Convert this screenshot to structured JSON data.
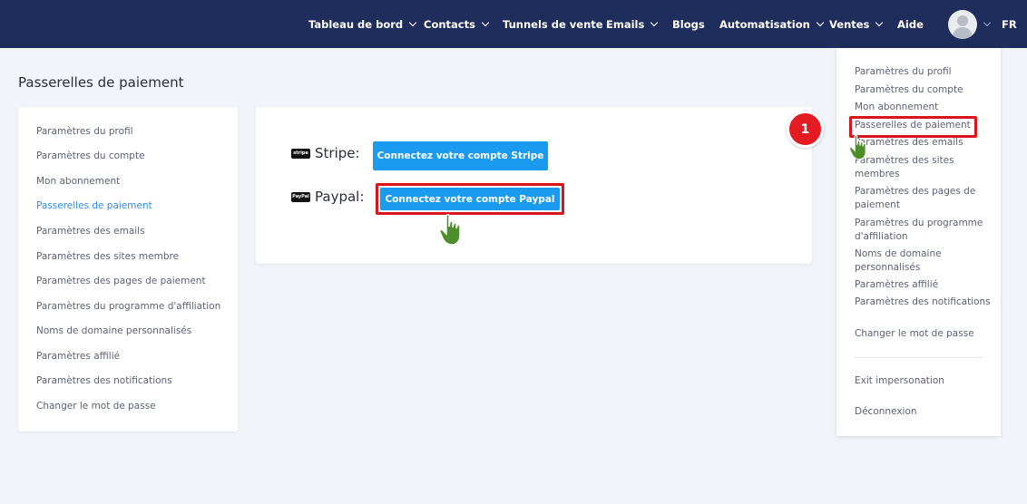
{
  "nav": {
    "items": [
      {
        "label": "Tableau de bord",
        "has_dropdown": true
      },
      {
        "label": "Contacts",
        "has_dropdown": true
      },
      {
        "label": "Tunnels de vente",
        "has_dropdown": false
      },
      {
        "label": "Emails",
        "has_dropdown": true
      },
      {
        "label": "Blogs",
        "has_dropdown": false
      },
      {
        "label": "Automatisation",
        "has_dropdown": true
      },
      {
        "label": "Ventes",
        "has_dropdown": true
      },
      {
        "label": "Aide",
        "has_dropdown": false
      }
    ],
    "language": "FR"
  },
  "page": {
    "title": "Passerelles de paiement"
  },
  "left_menu": {
    "items": [
      {
        "label": "Paramètres du profil",
        "active": false
      },
      {
        "label": "Paramètres du compte",
        "active": false
      },
      {
        "label": "Mon abonnement",
        "active": false
      },
      {
        "label": "Passerelles de paiement",
        "active": true
      },
      {
        "label": "Paramètres des emails",
        "active": false
      },
      {
        "label": "Paramètres des sites membre",
        "active": false
      },
      {
        "label": "Paramètres des pages de paiement",
        "active": false
      },
      {
        "label": "Paramètres du programme d'affiliation",
        "active": false
      },
      {
        "label": "Noms de domaine personnalisés",
        "active": false
      },
      {
        "label": "Paramètres affilié",
        "active": false
      },
      {
        "label": "Paramètres des notifications",
        "active": false
      },
      {
        "label": "Changer le mot de passe",
        "active": false
      }
    ]
  },
  "gateways": {
    "stripe": {
      "logo_text": "stripe",
      "label": "Stripe:",
      "button": "Connectez votre compte Stripe"
    },
    "paypal": {
      "logo_text": "PayPal",
      "label": "Paypal:",
      "button": "Connectez votre compte Paypal"
    }
  },
  "user_dropdown": {
    "items": [
      "Paramètres du profil",
      "Paramètres du compte",
      "Mon abonnement",
      "Passerelles de paiement",
      "Paramètres des emails",
      "Paramètres des sites membres",
      "Paramètres des pages de paiement",
      "Paramètres du programme d'affiliation",
      "Noms de domaine personnalisés",
      "Paramètres affilié",
      "Paramètres des notifications",
      "Changer le mot de passe"
    ],
    "exit_impersonation": "Exit impersonation",
    "logout": "Déconnexion"
  },
  "annotation": {
    "step_number": "1"
  },
  "colors": {
    "nav_bg": "#1f2d5c",
    "primary": "#1b9bf0",
    "active_link": "#2d8cf0",
    "highlight": "#d9141c",
    "page_bg": "#f1f4f9"
  }
}
